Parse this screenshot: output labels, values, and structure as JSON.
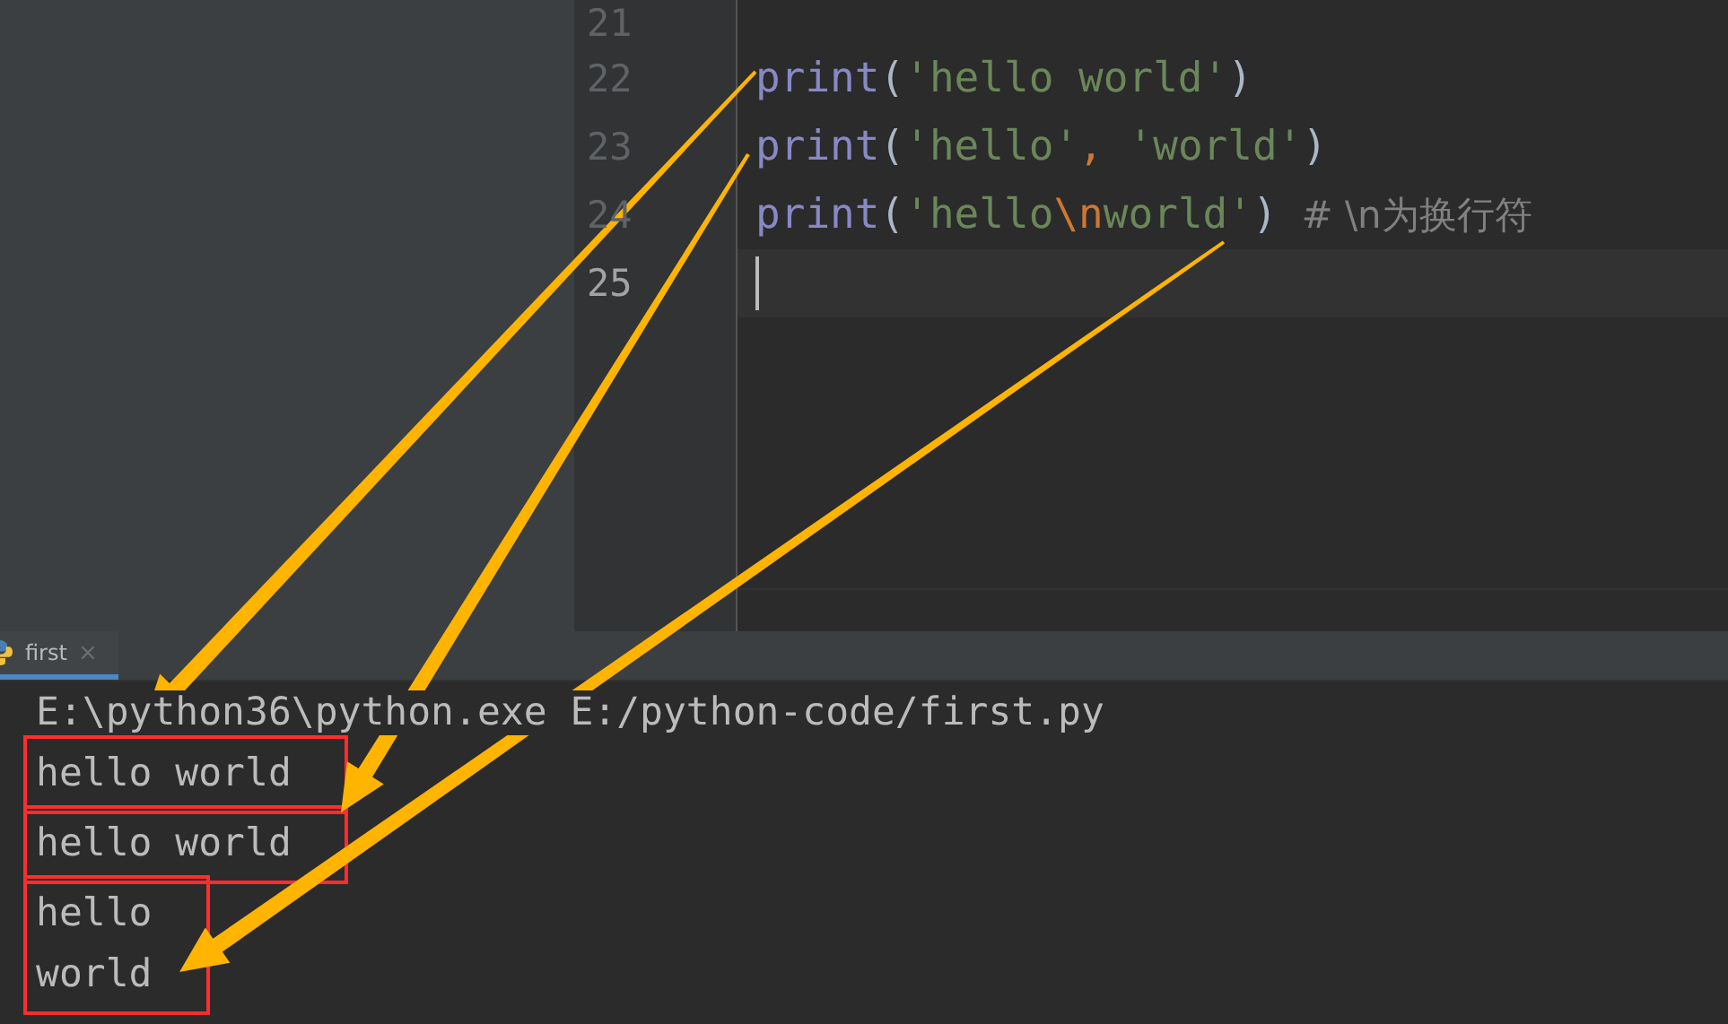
{
  "editor": {
    "lines": [
      {
        "number": "21",
        "current": false
      },
      {
        "number": "22",
        "current": false,
        "tokens": [
          {
            "kind": "fn",
            "text": "print"
          },
          {
            "kind": "paren",
            "text": "("
          },
          {
            "kind": "str",
            "text": "'hello world'"
          },
          {
            "kind": "paren",
            "text": ")"
          }
        ]
      },
      {
        "number": "23",
        "current": false,
        "tokens": [
          {
            "kind": "fn",
            "text": "print"
          },
          {
            "kind": "paren",
            "text": "("
          },
          {
            "kind": "str",
            "text": "'hello'"
          },
          {
            "kind": "comma",
            "text": ", "
          },
          {
            "kind": "str",
            "text": "'world'"
          },
          {
            "kind": "paren",
            "text": ")"
          }
        ]
      },
      {
        "number": "24",
        "current": false,
        "tokens": [
          {
            "kind": "fn",
            "text": "print"
          },
          {
            "kind": "paren",
            "text": "("
          },
          {
            "kind": "str",
            "text": "'hello"
          },
          {
            "kind": "escape",
            "text": "\\n"
          },
          {
            "kind": "str",
            "text": "world'"
          },
          {
            "kind": "paren",
            "text": ")"
          },
          {
            "kind": "comment",
            "text": "  # \\n为换行符"
          }
        ]
      },
      {
        "number": "25",
        "current": true
      }
    ]
  },
  "annotations": [
    {
      "kind": "arrow"
    },
    {
      "kind": "arrow"
    },
    {
      "kind": "arrow"
    }
  ],
  "run_panel": {
    "tabs": [
      {
        "label": "first",
        "close": "×",
        "selected": true
      }
    ],
    "output": [
      {
        "boxed": false,
        "lines": [
          "E:\\python36\\python.exe E:/python-code/first.py"
        ]
      },
      {
        "boxed": true,
        "lines": [
          "hello world"
        ]
      },
      {
        "boxed": true,
        "lines": [
          "hello world"
        ]
      },
      {
        "boxed": true,
        "lines": [
          "hello",
          "world"
        ]
      }
    ]
  }
}
